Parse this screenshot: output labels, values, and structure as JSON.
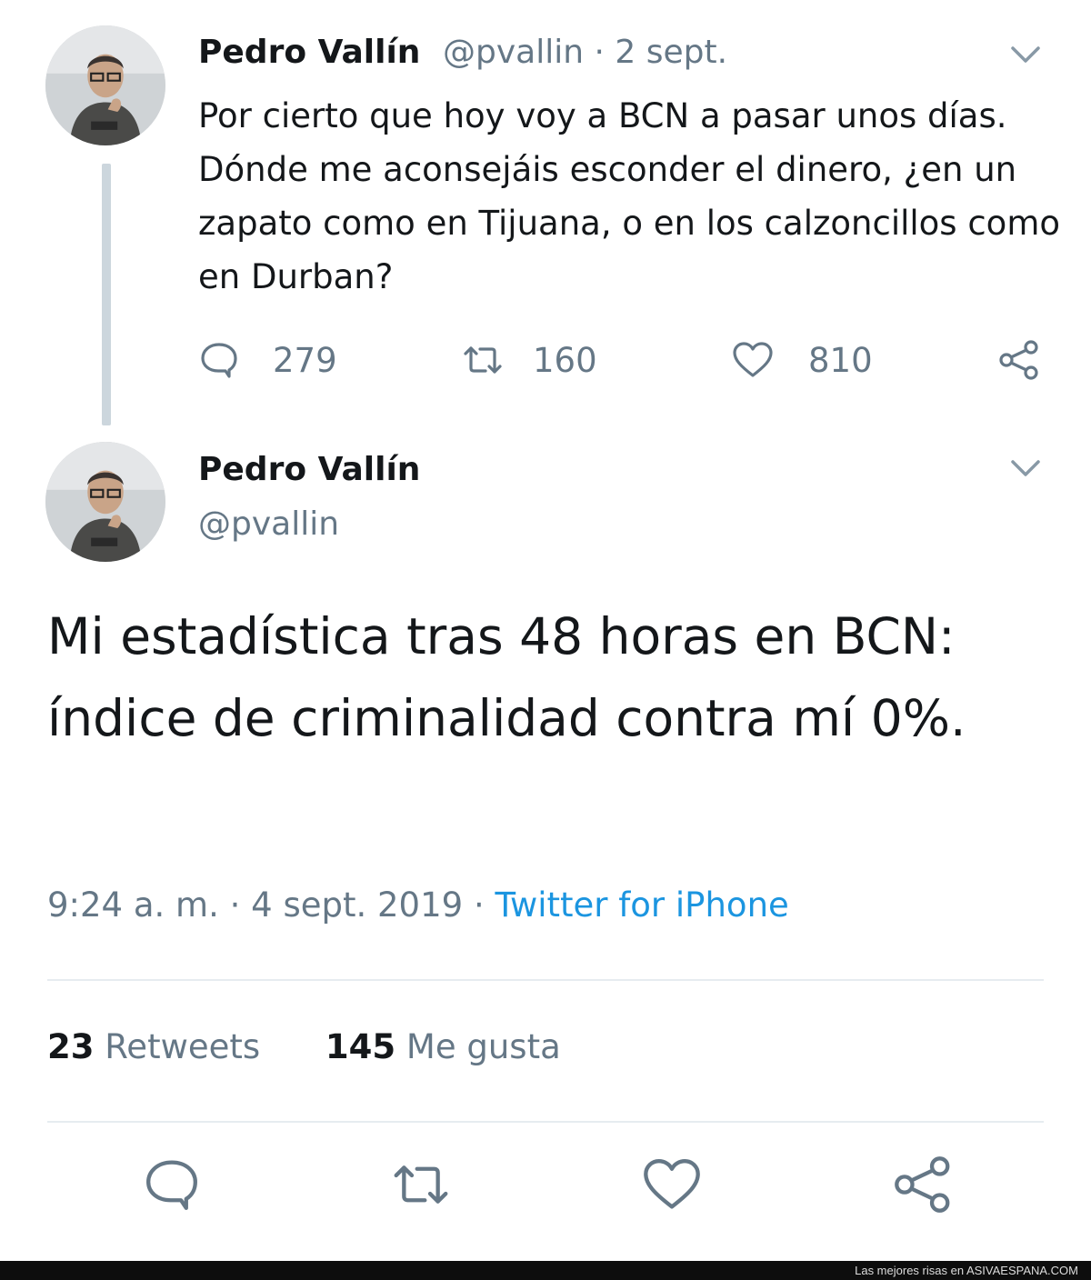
{
  "tweet1": {
    "author_name": "Pedro Vallín",
    "author_handle": "@pvallin",
    "date": "· 2 sept.",
    "text": "Por cierto que hoy voy a BCN a pasar unos días. Dónde me aconsejáis esconder el dinero, ¿en un zapato como en Tijuana, o en los calzoncillos como en Durban?",
    "replies": "279",
    "retweets": "160",
    "likes": "810"
  },
  "tweet2": {
    "author_name": "Pedro Vallín",
    "author_handle": "@pvallin",
    "text": "Mi estadística tras 48 horas en BCN: índice de criminalidad contra mí 0%.",
    "time": "9:24 a. m.",
    "date": "4 sept. 2019",
    "separator": "·",
    "source": "Twitter for iPhone",
    "retweet_count": "23",
    "retweet_label": "Retweets",
    "like_count": "145",
    "like_label": "Me gusta"
  },
  "icons": {
    "reply": "reply-icon",
    "retweet": "retweet-icon",
    "like": "heart-icon",
    "share": "share-icon",
    "menu": "chevron-down-icon"
  },
  "colors": {
    "text": "#14171a",
    "muted": "#657786",
    "link": "#1b95e0",
    "divider": "#e6ecf0"
  },
  "footer": {
    "text": "Las mejores risas en ASIVAESPANA.COM"
  }
}
